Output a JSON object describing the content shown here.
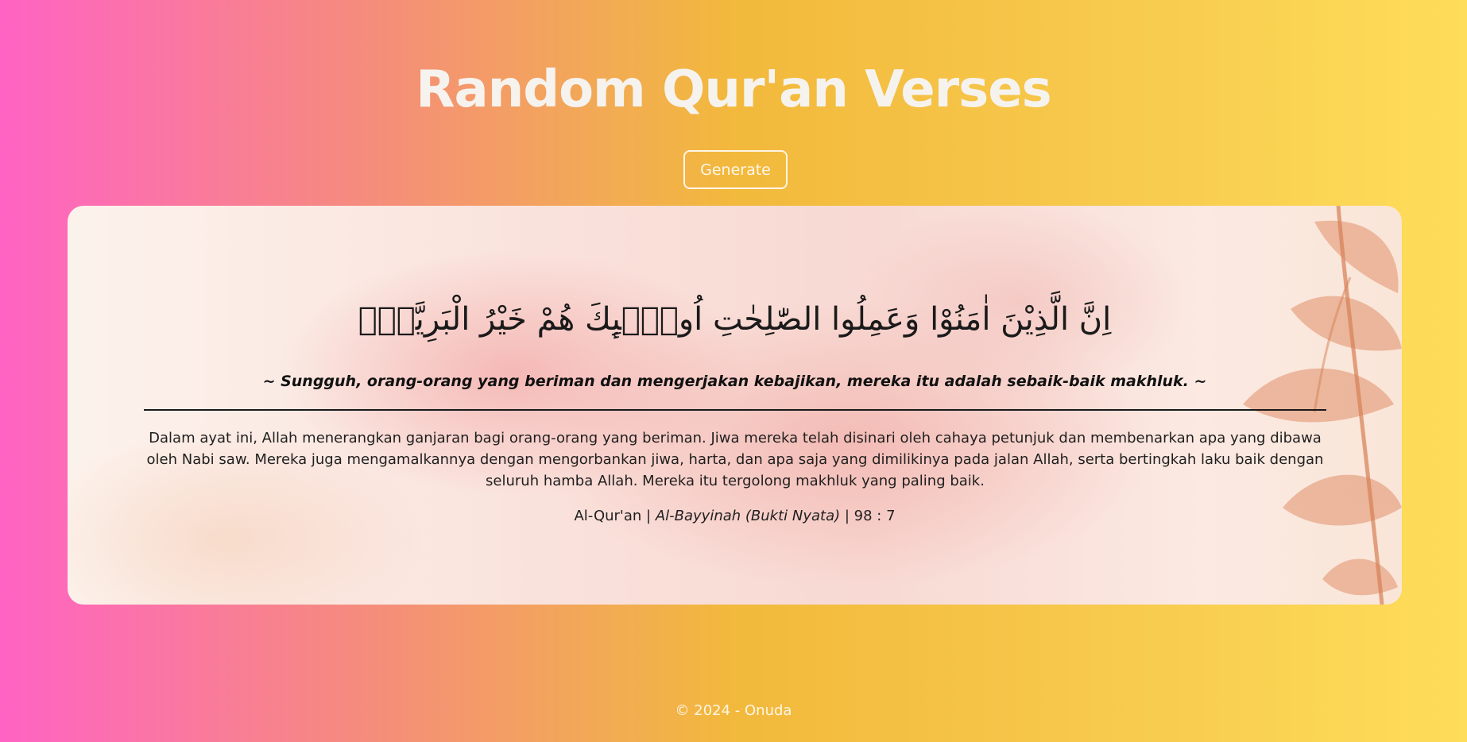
{
  "header": {
    "title": "Random Qur'an Verses",
    "generate_label": "Generate"
  },
  "verse": {
    "arabic": "اِنَّ الَّذِيْنَ اٰمَنُوْا وَعَمِلُوا الصّٰلِحٰتِ اُولٰۤىِٕكَ هُمْ خَيْرُ الْبَرِيَّةِۗ",
    "translation": "~ Sungguh, orang-orang yang beriman dan mengerjakan kebajikan, mereka itu adalah sebaik-baik makhluk. ~",
    "tafsir": "Dalam ayat ini, Allah menerangkan ganjaran bagi orang-orang yang beriman. Jiwa mereka telah disinari oleh cahaya petunjuk dan membenarkan apa yang dibawa oleh Nabi saw. Mereka juga mengamalkannya dengan mengorbankan jiwa, harta, dan apa saja yang dimilikinya pada jalan Allah, serta bertingkah laku baik dengan seluruh hamba Allah. Mereka itu tergolong makhluk yang paling baik.",
    "reference": {
      "source": "Al-Qur'an",
      "separator": " | ",
      "surah": "Al-Bayyinah (Bukti Nyata)",
      "ayah": "98 : 7"
    }
  },
  "footer": {
    "text": "© 2024 - Onuda"
  },
  "colors": {
    "gradient_left": "#ff63c4",
    "gradient_mid": "#f2b93c",
    "gradient_right": "#fedd5a",
    "title": "#f6f3ef",
    "leaf": "#e0906a"
  },
  "icons": {
    "decor": "leaf-decoration"
  }
}
